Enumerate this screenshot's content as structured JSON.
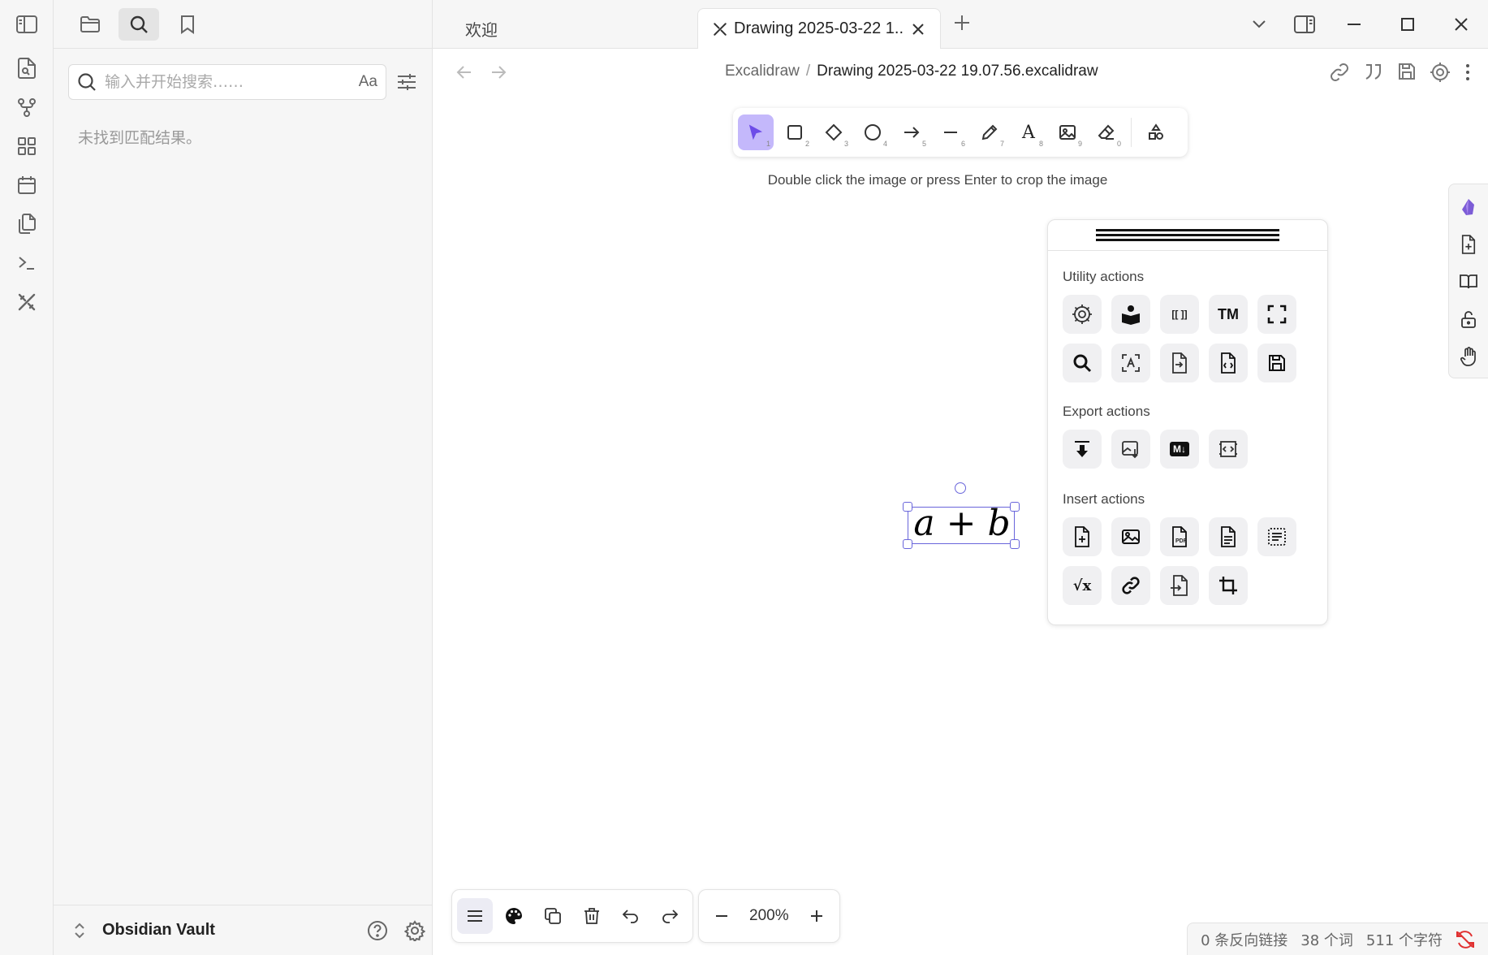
{
  "ribbon": {
    "items": [
      "open-quick-switcher",
      "graph-view",
      "canvas",
      "daily-note",
      "templates",
      "command-palette",
      "excalidraw"
    ]
  },
  "sidebar": {
    "search": {
      "placeholder": "输入并开始搜索……",
      "match_case": "Aa"
    },
    "no_results": "未找到匹配结果。",
    "vault_name": "Obsidian Vault"
  },
  "tabs": {
    "inactive_label": "欢迎",
    "active_label": "Drawing 2025-03-22 1..."
  },
  "breadcrumb": {
    "parent": "Excalidraw",
    "separator": "/",
    "file": "Drawing 2025-03-22 19.07.56.excalidraw"
  },
  "toolbar": {
    "tools": [
      {
        "name": "selection",
        "key": "1"
      },
      {
        "name": "rectangle",
        "key": "2"
      },
      {
        "name": "diamond",
        "key": "3"
      },
      {
        "name": "ellipse",
        "key": "4"
      },
      {
        "name": "arrow",
        "key": "5"
      },
      {
        "name": "line",
        "key": "6"
      },
      {
        "name": "draw",
        "key": "7"
      },
      {
        "name": "text",
        "key": "8",
        "glyph": "A"
      },
      {
        "name": "image",
        "key": "9"
      },
      {
        "name": "eraser",
        "key": "0"
      }
    ],
    "hint": "Double click the image or press Enter to crop the image"
  },
  "canvas": {
    "formula": "a + b"
  },
  "palette": {
    "utility_title": "Utility actions",
    "export_title": "Export actions",
    "insert_title": "Insert actions",
    "trademark_glyph": "TM",
    "markdown_glyph": "M↓",
    "pdf_glyph": "PDF",
    "math_glyph": "√x",
    "wiki_glyph": "[[ ]]"
  },
  "bottom": {
    "zoom": "200%"
  },
  "status": {
    "backlinks": "0 条反向链接",
    "words": "38 个词",
    "chars": "511 个字符"
  },
  "colors": {
    "accent": "#6965db",
    "tool_active": "#c4b8fb",
    "sync_error": "#e03131"
  }
}
